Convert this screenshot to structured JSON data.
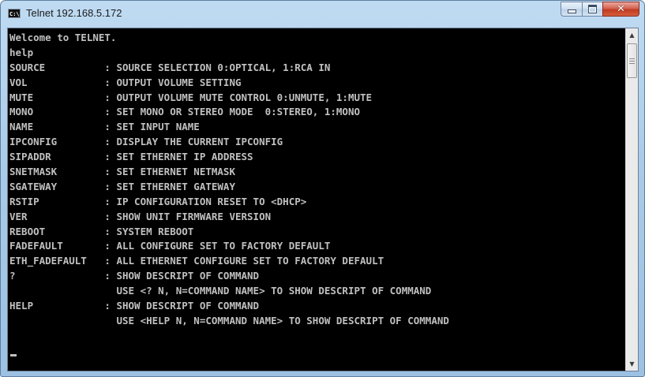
{
  "window": {
    "title": "Telnet 192.168.5.172",
    "app_icon_text": "C:\\",
    "close_glyph": "✕"
  },
  "console": {
    "lines": [
      "Welcome to TELNET.",
      "help",
      "SOURCE          : SOURCE SELECTION 0:OPTICAL, 1:RCA IN",
      "VOL             : OUTPUT VOLUME SETTING",
      "MUTE            : OUTPUT VOLUME MUTE CONTROL 0:UNMUTE, 1:MUTE",
      "MONO            : SET MONO OR STEREO MODE  0:STEREO, 1:MONO",
      "NAME            : SET INPUT NAME",
      "IPCONFIG        : DISPLAY THE CURRENT IPCONFIG",
      "SIPADDR         : SET ETHERNET IP ADDRESS",
      "SNETMASK        : SET ETHERNET NETMASK",
      "SGATEWAY        : SET ETHERNET GATEWAY",
      "RSTIP           : IP CONFIGURATION RESET TO <DHCP>",
      "VER             : SHOW UNIT FIRMWARE VERSION",
      "REBOOT          : SYSTEM REBOOT",
      "FADEFAULT       : ALL CONFIGURE SET TO FACTORY DEFAULT",
      "ETH_FADEFAULT   : ALL ETHERNET CONFIGURE SET TO FACTORY DEFAULT",
      "?               : SHOW DESCRIPT OF COMMAND",
      "                  USE <? N, N=COMMAND NAME> TO SHOW DESCRIPT OF COMMAND",
      "HELP            : SHOW DESCRIPT OF COMMAND",
      "                  USE <HELP N, N=COMMAND NAME> TO SHOW DESCRIPT OF COMMAND"
    ]
  },
  "scrollbar": {
    "up_arrow": "▲",
    "down_arrow": "▼",
    "position": 0
  }
}
